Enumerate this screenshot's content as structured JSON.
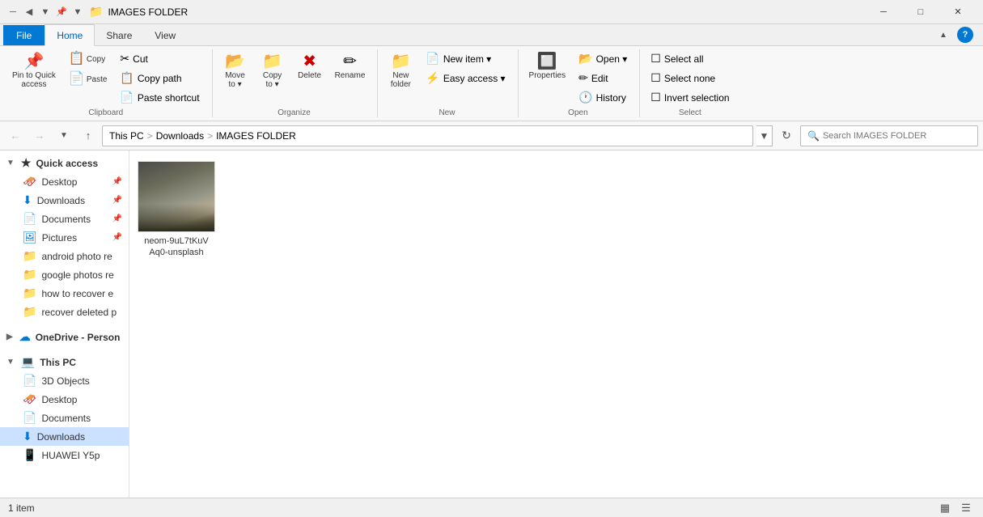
{
  "titlebar": {
    "title": "IMAGES FOLDER",
    "folder_icon": "📁",
    "icons": [
      "◀",
      "▼",
      "📌",
      "▼"
    ],
    "minimize": "─",
    "maximize": "□",
    "close": "✕"
  },
  "ribbon": {
    "tabs": [
      "File",
      "Home",
      "Share",
      "View"
    ],
    "active_tab": "Home",
    "groups": {
      "clipboard": {
        "label": "Clipboard",
        "pin_label": "Pin to Quick\naccess",
        "pin_icon": "📌",
        "copy_label": "Copy",
        "copy_icon": "📋",
        "paste_label": "Paste",
        "paste_icon": "📄",
        "cut_label": "Cut",
        "cut_icon": "✂",
        "copy_path_label": "Copy path",
        "paste_shortcut_label": "Paste shortcut"
      },
      "organize": {
        "label": "Organize",
        "move_to_label": "Move\nto ▾",
        "move_to_icon": "📂",
        "copy_to_label": "Copy\nto ▾",
        "copy_to_icon": "📁",
        "delete_label": "Delete",
        "delete_icon": "✖",
        "rename_label": "Rename",
        "rename_icon": "✏"
      },
      "new": {
        "label": "New",
        "new_folder_label": "New\nfolder",
        "new_folder_icon": "📁",
        "new_item_label": "New item ▾",
        "easy_access_label": "Easy access ▾"
      },
      "open": {
        "label": "Open",
        "properties_label": "Properties",
        "properties_icon": "🔧",
        "open_label": "Open ▾",
        "edit_label": "Edit",
        "history_label": "History"
      },
      "select": {
        "label": "Select",
        "select_all_label": "Select all",
        "select_none_label": "Select none",
        "invert_label": "Invert selection"
      }
    }
  },
  "address_bar": {
    "path_parts": [
      "This PC",
      "Downloads",
      "IMAGES FOLDER"
    ],
    "search_placeholder": "Search IMAGES FOLDER"
  },
  "sidebar": {
    "quick_access_label": "Quick access",
    "items": [
      {
        "label": "Desktop",
        "icon": "🖥",
        "type": "quick",
        "pinned": true
      },
      {
        "label": "Downloads",
        "icon": "⬇",
        "type": "quick",
        "pinned": true
      },
      {
        "label": "Documents",
        "icon": "📄",
        "type": "quick",
        "pinned": true
      },
      {
        "label": "Pictures",
        "icon": "🖼",
        "type": "quick",
        "pinned": true
      },
      {
        "label": "android photo re",
        "icon": "📁",
        "type": "folder"
      },
      {
        "label": "google photos re",
        "icon": "📁",
        "type": "folder"
      },
      {
        "label": "how to recover e",
        "icon": "📁",
        "type": "folder"
      },
      {
        "label": "recover deleted p",
        "icon": "📁",
        "type": "folder"
      }
    ],
    "onedrive_label": "OneDrive - Person",
    "this_pc_label": "This PC",
    "this_pc_items": [
      {
        "label": "3D Objects",
        "icon": "📦",
        "type": "system"
      },
      {
        "label": "Desktop",
        "icon": "🖥",
        "type": "system"
      },
      {
        "label": "Documents",
        "icon": "📄",
        "type": "system"
      },
      {
        "label": "Downloads",
        "icon": "⬇",
        "type": "system",
        "selected": true
      },
      {
        "label": "HUAWEI Y5p",
        "icon": "📱",
        "type": "device"
      }
    ]
  },
  "files": [
    {
      "name": "neom-9uL7tKuV\nAq0-unsplash",
      "type": "image"
    }
  ],
  "status_bar": {
    "item_count": "1 item"
  }
}
